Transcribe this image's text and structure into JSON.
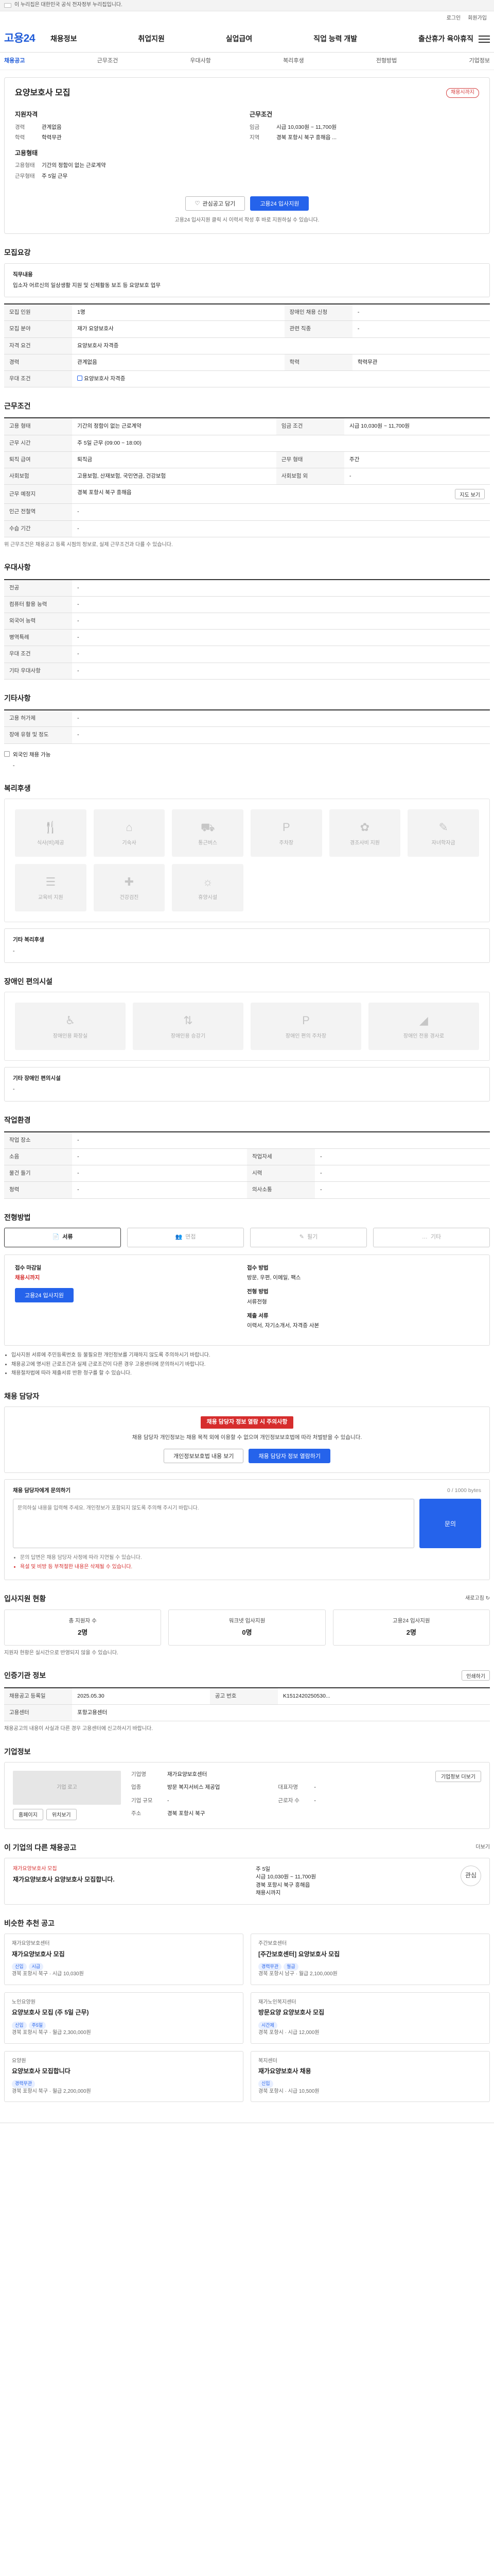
{
  "gov_banner": "이 누리집은 대한민국 공식 전자정부 누리집입니다.",
  "util": {
    "links": [
      "로그인",
      "회원가입"
    ]
  },
  "gnb": {
    "logo": "고용24",
    "menu": [
      "채용정보",
      "취업지원",
      "실업급여",
      "직업 능력 개발",
      "출산휴가 육아휴직"
    ]
  },
  "subnav": [
    "채용공고",
    "근무조건",
    "우대사항",
    "복리후생",
    "전형방법",
    "기업정보"
  ],
  "job": {
    "title": "요양보호사 모집",
    "badge": "채용시까지",
    "applicant_head": "지원자격",
    "applicant": [
      {
        "k": "경력",
        "v": "관계없음"
      },
      {
        "k": "학력",
        "v": "학력무관"
      }
    ],
    "condition_head": "근무조건",
    "condition": [
      {
        "k": "임금",
        "v": "시급 10,030원 ~ 11,700원"
      },
      {
        "k": "지역",
        "v": "경북 포항시 북구 흥해읍 ..."
      }
    ],
    "form_head": "고용형태",
    "form": [
      {
        "k": "고용형태",
        "v": "기간의 정함이 없는 근로계약"
      },
      {
        "k": "근무형태",
        "v": "주 5일 근무"
      }
    ],
    "scrap_label": "관심공고 담기",
    "apply_label": "고용24 입사지원",
    "note": "고용24 입사지원 클릭 시 이력서 작성 후 바로 지원하실 수 있습니다."
  },
  "recruit": {
    "title": "모집요강",
    "duty_head": "직무내용",
    "duty": "입소자 어르신의 일상생활 지원 및 신체활동 보조 등 요양보호 업무",
    "rows": [
      {
        "k": "모집 인원",
        "v": "1명",
        "k2": "장애인 채용 신청",
        "v2": "-"
      },
      {
        "k": "모집 분야",
        "v": "재가 요양보호사",
        "k2": "관련 직종",
        "v2": "-"
      },
      {
        "k": "자격 요건",
        "v": "요양보호사 자격증",
        "k2": "",
        "v2": ""
      },
      {
        "k": "경력",
        "v": "관계없음",
        "k2": "학력",
        "v2": "학력무관"
      },
      {
        "k": "우대 조건",
        "v": "요양보호사 자격증",
        "k2": "",
        "v2": ""
      }
    ]
  },
  "conditions": {
    "title": "근무조건",
    "rows": [
      {
        "k": "고용 형태",
        "v": "기간의 정함이 없는 근로계약",
        "k2": "임금 조건",
        "v2": "시급 10,030원 ~ 11,700원"
      },
      {
        "k": "근무 시간",
        "v": "주 5일 근무 (09:00 ~ 18:00)",
        "k2": "",
        "v2": ""
      },
      {
        "k": "퇴직 급여",
        "v": "퇴직금",
        "k2": "근무 형태",
        "v2": "주간"
      },
      {
        "k": "사회보험",
        "v": "고용보험, 산재보험, 국민연금, 건강보험",
        "k2": "사회보험 외",
        "v2": "-"
      },
      {
        "k": "근무 예정지",
        "v": "경북 포항시 북구 흥해읍",
        "k2": "",
        "v2": ""
      },
      {
        "k": "인근 전철역",
        "v": "-",
        "k2": "",
        "v2": ""
      },
      {
        "k": "수습 기간",
        "v": "-",
        "k2": "",
        "v2": ""
      }
    ],
    "map_label": "지도 보기",
    "note": "위 근무조건은 채용공고 등록 시점의 정보로, 실제 근무조건과 다를 수 있습니다."
  },
  "preference": {
    "title": "우대사항",
    "rows": [
      {
        "k": "전공",
        "v": "-"
      },
      {
        "k": "컴퓨터 활용 능력",
        "v": "-"
      },
      {
        "k": "외국어 능력",
        "v": "-"
      },
      {
        "k": "병역특례",
        "v": "-"
      },
      {
        "k": "우대 조건",
        "v": "-"
      },
      {
        "k": "기타 우대사항",
        "v": "-"
      }
    ]
  },
  "other": {
    "title": "기타사항",
    "rows": [
      {
        "k": "고용 허가제",
        "v": "-"
      },
      {
        "k": "장애 유형 및 정도",
        "v": "-"
      }
    ],
    "foreigner_label": "외국인 채용 가능",
    "foreigner_value": "-"
  },
  "welfare": {
    "title": "복리후생",
    "tiles": [
      "식사(비)제공",
      "기숙사",
      "통근버스",
      "주차장",
      "경조사비 지원",
      "자녀학자금",
      "교육비 지원",
      "건강검진",
      "휴양시설"
    ],
    "icons": [
      "🍴",
      "⌂",
      "⛟",
      "P",
      "✿",
      "✎",
      "☰",
      "✚",
      "☼"
    ],
    "etc_label": "기타 복리후생",
    "etc_value": "-"
  },
  "disability": {
    "title": "장애인 편의시설",
    "tiles": [
      "장애인용 화장실",
      "장애인용 승강기",
      "장애인 편의 주차장",
      "장애인 전용 경사로"
    ],
    "icons": [
      "♿",
      "⇅",
      "P",
      "◢"
    ],
    "etc_label": "기타 장애인 편의시설",
    "etc_value": "-"
  },
  "workplace": {
    "title": "작업환경",
    "rows": [
      {
        "k": "작업 장소",
        "v": "-",
        "k2": "",
        "v2": ""
      },
      {
        "k": "소음",
        "v": "-",
        "k2": "작업자세",
        "v2": "-"
      },
      {
        "k": "물건 들기",
        "v": "-",
        "k2": "시력",
        "v2": "-"
      },
      {
        "k": "청력",
        "v": "-",
        "k2": "의사소통",
        "v2": "-"
      }
    ]
  },
  "method": {
    "title": "전형방법",
    "tabs": [
      "서류",
      "면접",
      "필기",
      "기타"
    ],
    "tab_icons": [
      "📄",
      "👥",
      "✎",
      "…"
    ],
    "period_label": "접수 마감일",
    "period_value": "채용시까지",
    "way_label": "접수 방법",
    "way_value": "방문, 우편, 이메일, 팩스",
    "select_label": "전형 방법",
    "select_value": "서류전형",
    "docs_label": "제출 서류",
    "docs_value": "이력서, 자기소개서, 자격증 사본",
    "apply_label": "고용24 입사지원",
    "bullets": [
      "입사지원 서류에 주민등록번호 등 불필요한 개인정보를 기재하지 않도록 주의하시기 바랍니다.",
      "채용공고에 명시된 근로조건과 실제 근로조건이 다른 경우 고용센터에 문의하시기 바랍니다.",
      "채용절차법에 따라 제출서류 반환 청구를 할 수 있습니다."
    ]
  },
  "contact": {
    "title": "채용 담당자",
    "warn": "채용 담당자 정보 열람 시 주의사항",
    "text": "채용 담당자 개인정보는 채용 목적 외에 이용할 수 없으며 개인정보보호법에 따라 처벌받을 수 있습니다.",
    "btn_agree": "개인정보보호법 내용 보기",
    "btn_view": "채용 담당자 정보 열람하기"
  },
  "inquiry": {
    "title": "채용 담당자에게 문의하기",
    "counter": "0 / 1000 bytes",
    "placeholder": "문의하실 내용을 입력해 주세요. 개인정보가 포함되지 않도록 주의해 주시기 바랍니다.",
    "submit": "문의",
    "notes": [
      "문의 답변은 채용 담당자 사정에 따라 지연될 수 있습니다.",
      "욕설 및 비방 등 부적절한 내용은 삭제될 수 있습니다."
    ]
  },
  "applicants": {
    "title": "입사지원 현황",
    "refresh": "새로고침",
    "stats": [
      {
        "l": "총 지원자 수",
        "v": "2명"
      },
      {
        "l": "워크넷 입사지원",
        "v": "0명"
      },
      {
        "l": "고용24 입사지원",
        "v": "2명"
      }
    ],
    "note": "지원자 현황은 실시간으로 반영되지 않을 수 있습니다."
  },
  "regist": {
    "title": "인증기관 정보",
    "print_label": "인쇄하기",
    "rows": [
      {
        "k": "채용공고 등록일",
        "v": "2025.05.30",
        "k2": "공고 번호",
        "v2": "K1512420250530..."
      },
      {
        "k": "고용센터",
        "v": "포항고용센터",
        "k2": "",
        "v2": ""
      }
    ],
    "note": "채용공고의 내용이 사실과 다른 경우 고용센터에 신고하시기 바랍니다."
  },
  "company": {
    "title": "기업정보",
    "logo_placeholder": "기업 로고",
    "name_label": "기업명",
    "name": "재가요양보호센터",
    "btn_more": "기업정보 더보기",
    "rows": [
      {
        "k": "업종",
        "v": "방문 복지서비스 제공업",
        "k2": "대표자명",
        "v2": "-"
      },
      {
        "k": "기업 규모",
        "v": "-",
        "k2": "근로자 수",
        "v2": "-"
      },
      {
        "k": "주소",
        "v": "경북 포항시 북구",
        "k2": "",
        "v2": ""
      }
    ],
    "homepage": "홈페이지",
    "location": "위치보기"
  },
  "other_jobs": {
    "title": "이 기업의 다른 채용공고",
    "more": "더보기",
    "heading": "재가요양보호사 모집",
    "text": "재가요양보호사 요양보호사 모집합니다.",
    "conditions": [
      "주 5일",
      "시급 10,030원 ~ 11,700원",
      "경북 포항시 북구 흥해읍",
      "채용시까지"
    ],
    "scrap": "관심"
  },
  "recommend": {
    "title": "비슷한 추천 공고",
    "items": [
      {
        "company": "재가요양보호센터",
        "title": "재가요양보호사 모집",
        "pills": [
          "신입",
          "시급"
        ],
        "meta": "경북 포항시 북구 · 시급 10,030원"
      },
      {
        "company": "주간보호센터",
        "title": "[주간보호센터] 요양보호사 모집",
        "pills": [
          "경력무관",
          "월급"
        ],
        "meta": "경북 포항시 남구 · 월급 2,100,000원"
      },
      {
        "company": "노인요양원",
        "title": "요양보호사 모집 (주 5일 근무)",
        "pills": [
          "신입",
          "주5일"
        ],
        "meta": "경북 포항시 북구 · 월급 2,300,000원"
      },
      {
        "company": "재가노인복지센터",
        "title": "방문요양 요양보호사 모집",
        "pills": [
          "시간제"
        ],
        "meta": "경북 포항시 · 시급 12,000원"
      },
      {
        "company": "요양원",
        "title": "요양보호사 모집합니다",
        "pills": [
          "경력무관"
        ],
        "meta": "경북 포항시 북구 · 월급 2,200,000원"
      },
      {
        "company": "복지센터",
        "title": "재가요양보호사 채용",
        "pills": [
          "신입"
        ],
        "meta": "경북 포항시 · 시급 10,500원"
      }
    ]
  }
}
